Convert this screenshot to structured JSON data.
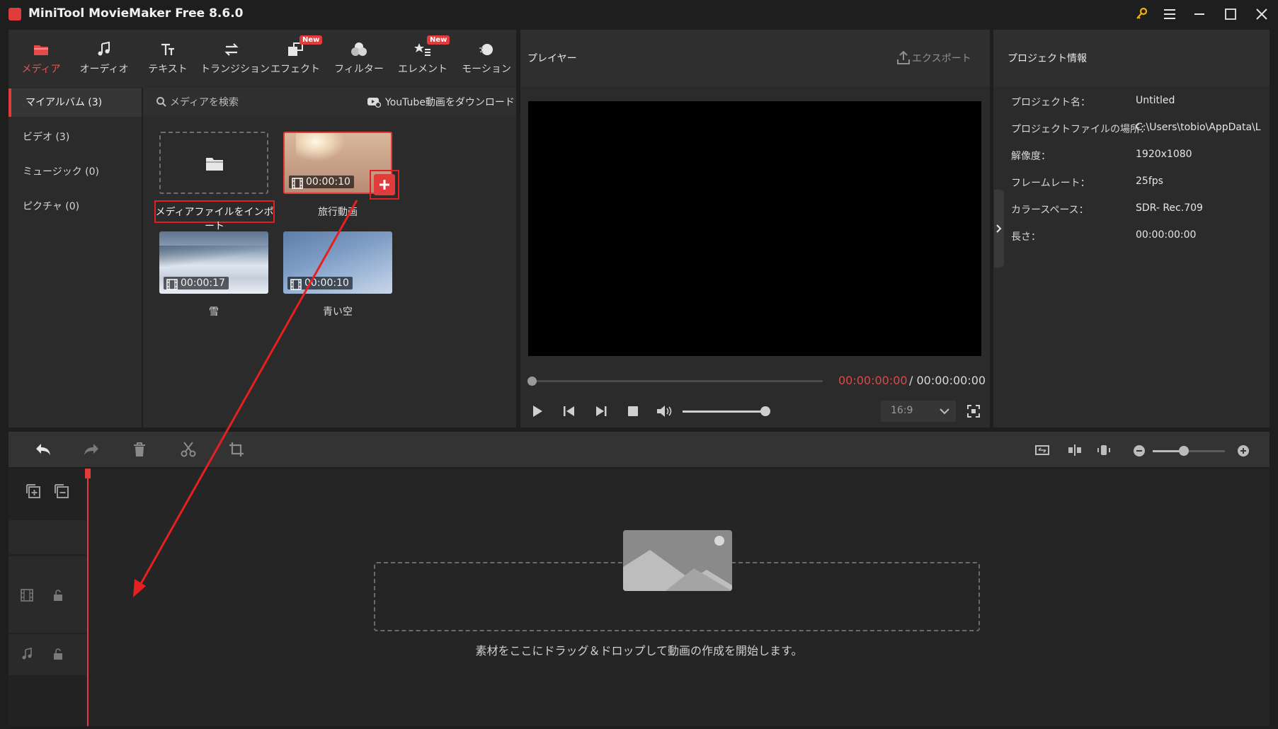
{
  "window": {
    "title": "MiniTool MovieMaker Free 8.6.0"
  },
  "tabs": [
    {
      "label": "メディア",
      "icon": "folder-icon",
      "active": true
    },
    {
      "label": "オーディオ",
      "icon": "music-note-icon"
    },
    {
      "label": "テキスト",
      "icon": "text-icon"
    },
    {
      "label": "トランジション",
      "icon": "swap-arrows-icon"
    },
    {
      "label": "エフェクト",
      "icon": "effect-icon",
      "badge": "New"
    },
    {
      "label": "フィルター",
      "icon": "filter-icon"
    },
    {
      "label": "エレメント",
      "icon": "element-icon",
      "badge": "New"
    },
    {
      "label": "モーション",
      "icon": "motion-icon"
    }
  ],
  "albums": [
    {
      "label": "マイアルバム (3)",
      "active": true
    },
    {
      "label": "ビデオ (3)"
    },
    {
      "label": "ミュージック (0)"
    },
    {
      "label": "ピクチャ (0)"
    }
  ],
  "media_search": {
    "placeholder": "メディアを検索",
    "youtube": "YouTube動画をダウンロード"
  },
  "media_items": {
    "import_label": "メディアファイルをインポート",
    "items": [
      {
        "name": "旅行動画",
        "duration": "00:00:10"
      },
      {
        "name": "雪",
        "duration": "00:00:17"
      },
      {
        "name": "青い空",
        "duration": "00:00:10"
      }
    ]
  },
  "player": {
    "title": "プレイヤー",
    "export": "エクスポート",
    "current_time": "00:00:00:00",
    "total_time": "/ 00:00:00:00",
    "aspect_ratio": "16:9"
  },
  "project_info": {
    "title": "プロジェクト情報",
    "rows": [
      {
        "key": "プロジェクト名：",
        "value": "Untitled"
      },
      {
        "key": "プロジェクトファイルの場所：",
        "value": "C:\\Users\\tobio\\AppData\\L"
      },
      {
        "key": "解像度：",
        "value": "1920x1080"
      },
      {
        "key": "フレームレート：",
        "value": "25fps"
      },
      {
        "key": "カラースペース：",
        "value": "SDR- Rec.709"
      },
      {
        "key": "長さ：",
        "value": "00:00:00:00"
      }
    ]
  },
  "timeline": {
    "drop_text": "素材をここにドラッグ＆ドロップして動画の作成を開始します。"
  },
  "colors": {
    "accent": "#e03c3c",
    "annotation": "#e02020",
    "bg": "#1e1e1e",
    "panel": "#2b2b2b"
  }
}
